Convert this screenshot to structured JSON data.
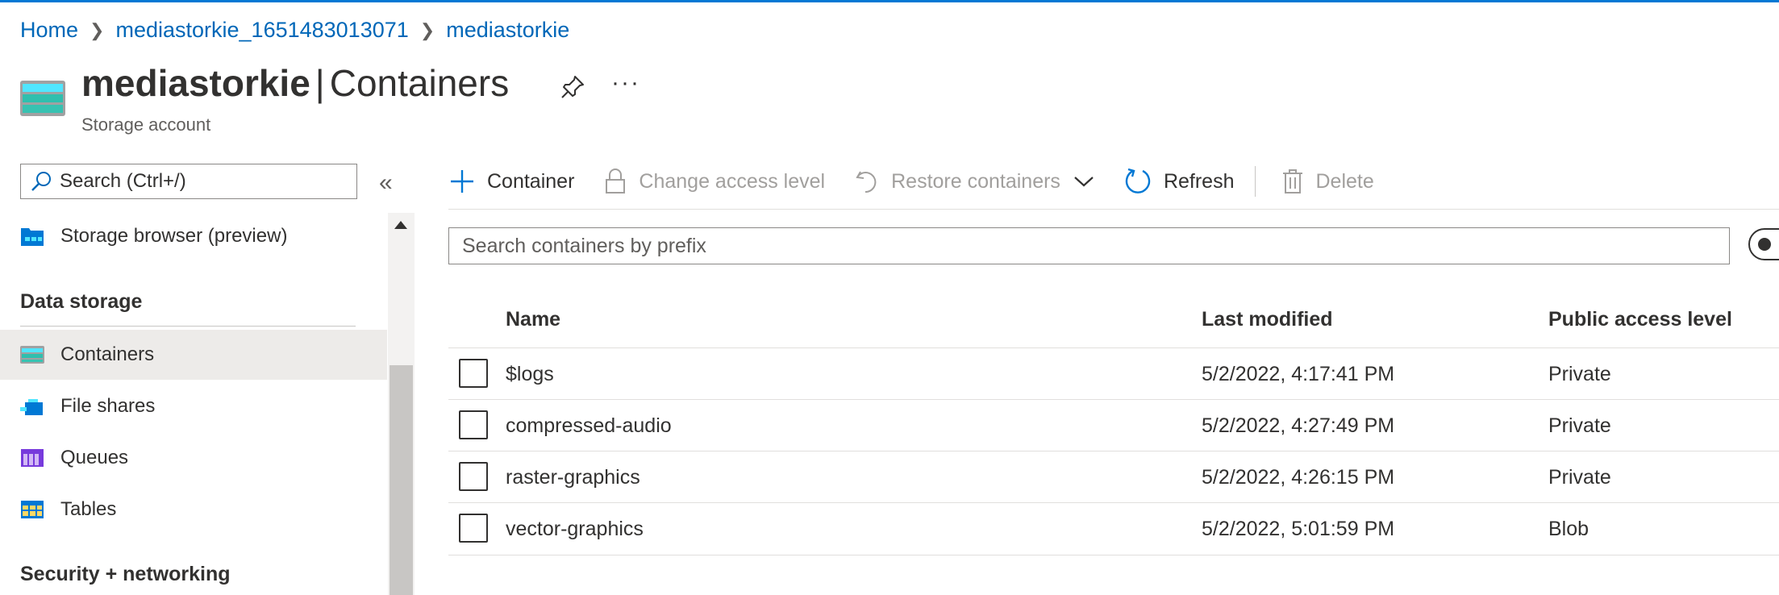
{
  "breadcrumb": [
    "Home",
    "mediastorkie_1651483013071",
    "mediastorkie"
  ],
  "header": {
    "resource_name": "mediastorkie",
    "separator": "|",
    "page": "Containers",
    "subtitle": "Storage account",
    "more": "···"
  },
  "nav": {
    "search_placeholder": "Search (Ctrl+/)",
    "collapse": "«",
    "items": {
      "storage_browser": "Storage browser (preview)",
      "data_storage": "Data storage",
      "containers": "Containers",
      "file_shares": "File shares",
      "queues": "Queues",
      "tables": "Tables",
      "security_networking": "Security + networking"
    },
    "selected": "Containers"
  },
  "toolbar": {
    "add_container": "Container",
    "change_access_level": "Change access level",
    "restore_containers": "Restore containers",
    "refresh": "Refresh",
    "delete": "Delete"
  },
  "filter": {
    "placeholder": "Search containers by prefix"
  },
  "table": {
    "columns": [
      "Name",
      "Last modified",
      "Public access level"
    ],
    "rows": [
      {
        "name": "$logs",
        "last_modified": "5/2/2022, 4:17:41 PM",
        "access": "Private"
      },
      {
        "name": "compressed-audio",
        "last_modified": "5/2/2022, 4:27:49 PM",
        "access": "Private"
      },
      {
        "name": "raster-graphics",
        "last_modified": "5/2/2022, 4:26:15 PM",
        "access": "Private"
      },
      {
        "name": "vector-graphics",
        "last_modified": "5/2/2022, 5:01:59 PM",
        "access": "Blob"
      }
    ]
  },
  "colors": {
    "accent": "#0078d4",
    "link": "#0067b8",
    "selected_bg": "#edebe9",
    "disabled_text": "#a19f9d"
  }
}
